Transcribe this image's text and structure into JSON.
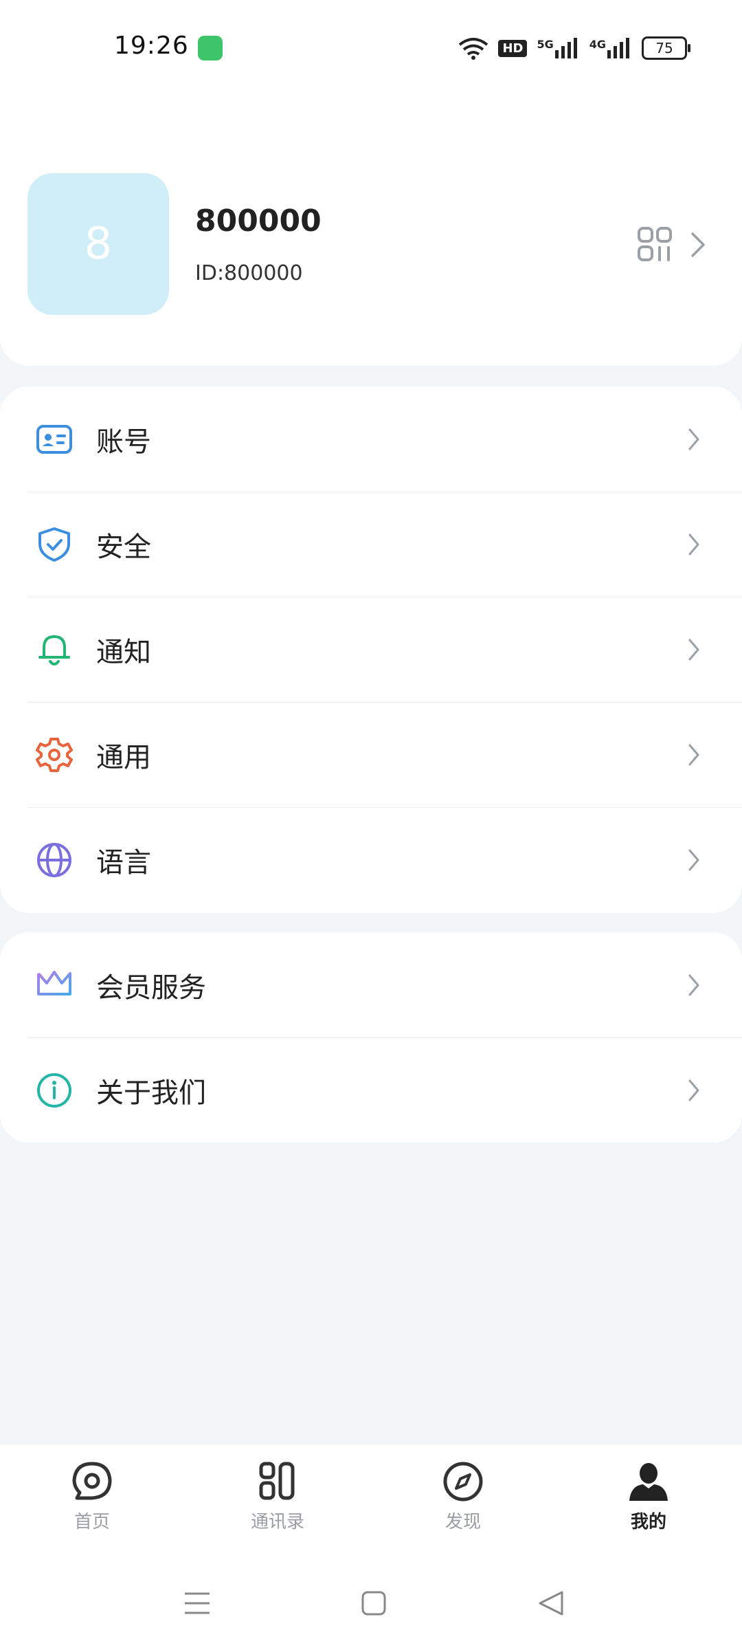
{
  "status_bar": {
    "time": "19:26",
    "wifi_icon": "wifi-icon",
    "hd_badge": "HD",
    "signal_5g": "5G",
    "signal_4g": "4G",
    "battery": "75"
  },
  "profile": {
    "avatar_initial": "8",
    "avatar_bg": "#cfeef8",
    "username": "800000",
    "user_id": "ID:800000",
    "qr_icon": "qr-code-icon"
  },
  "menu_group_1": [
    {
      "label": "账号",
      "icon": "id-card-icon",
      "color": "#3b8ee0"
    },
    {
      "label": "安全",
      "icon": "shield-check-icon",
      "color": "#3b8ee0"
    },
    {
      "label": "通知",
      "icon": "bell-icon",
      "color": "#22b573"
    },
    {
      "label": "通用",
      "icon": "gear-icon",
      "color": "#e8643c"
    },
    {
      "label": "语言",
      "icon": "globe-icon",
      "color": "#7b6fe0"
    }
  ],
  "menu_group_2": [
    {
      "label": "会员服务",
      "icon": "crown-icon",
      "color": "#8e6fe8"
    },
    {
      "label": "关于我们",
      "icon": "info-icon",
      "color": "#22b5a8"
    }
  ],
  "bottom_nav": [
    {
      "label": "首页",
      "icon": "chat-bubble-icon",
      "active": false
    },
    {
      "label": "通讯录",
      "icon": "contacts-icon",
      "active": false
    },
    {
      "label": "发现",
      "icon": "compass-icon",
      "active": false
    },
    {
      "label": "我的",
      "icon": "person-icon",
      "active": true
    }
  ],
  "system_nav": [
    "menu-icon",
    "home-square-icon",
    "back-triangle-icon"
  ]
}
